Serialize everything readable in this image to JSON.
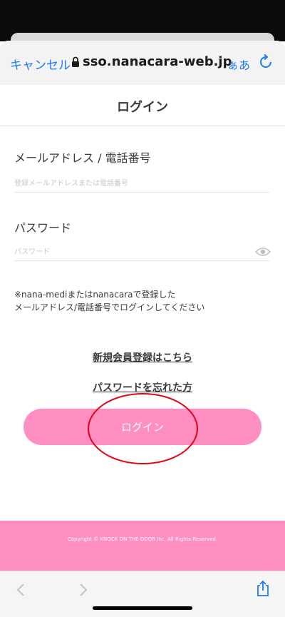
{
  "browser": {
    "cancel_label": "キャンセル",
    "url": "sso.nanacara-web.jp",
    "text_size_label": "ぁあ"
  },
  "page": {
    "title": "ログイン",
    "email": {
      "label": "メールアドレス / 電話番号",
      "placeholder": "登録メールアドレスまたは電話番号",
      "value": ""
    },
    "password": {
      "label": "パスワード",
      "placeholder": "パスワード",
      "value": ""
    },
    "note_line1": "※nana-mediまたはnanacaraで登録した",
    "note_line2": "メールアドレス/電話番号でログインしてください",
    "register_link": "新規会員登録はこちら",
    "forgot_link": "パスワードを忘れた方",
    "login_button": "ログイン",
    "footer_copyright": "Copyright © KNOCK ON THE DOOR Inc. All Rights Reserved."
  },
  "colors": {
    "accent_pink": "#ff8ec1",
    "link_blue": "#1b7cf5",
    "annotation_red": "#e60012"
  }
}
